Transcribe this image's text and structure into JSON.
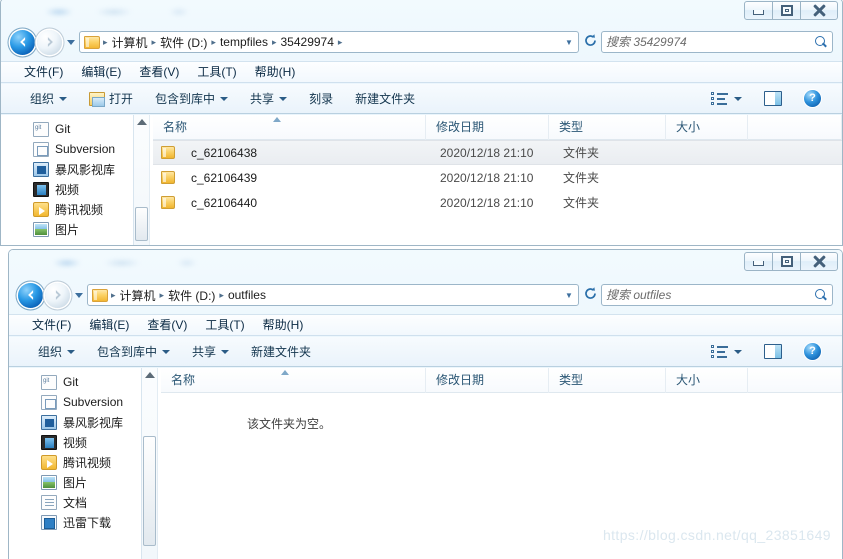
{
  "windows": [
    {
      "id": "win-tempfiles",
      "breadcrumb": {
        "items": [
          "计算机",
          "软件 (D:)",
          "tempfiles",
          "35429974"
        ],
        "separator": "▸"
      },
      "search": {
        "placeholder": "搜索 35429974",
        "value": ""
      },
      "menubar": [
        "文件(F)",
        "编辑(E)",
        "查看(V)",
        "工具(T)",
        "帮助(H)"
      ],
      "toolbar": {
        "organize": "组织",
        "open": "打开",
        "include_in_library": "包含到库中",
        "share": "共享",
        "burn": "刻录",
        "new_folder": "新建文件夹",
        "help_glyph": "?"
      },
      "nav_items": [
        "Git",
        "Subversion",
        "暴风影视库",
        "视频",
        "腾讯视频",
        "图片"
      ],
      "columns": [
        "名称",
        "修改日期",
        "类型",
        "大小"
      ],
      "rows": [
        {
          "name": "c_62106438",
          "modified": "2020/12/18 21:10",
          "type": "文件夹",
          "size": "",
          "selected": true
        },
        {
          "name": "c_62106439",
          "modified": "2020/12/18 21:10",
          "type": "文件夹",
          "size": "",
          "selected": false
        },
        {
          "name": "c_62106440",
          "modified": "2020/12/18 21:10",
          "type": "文件夹",
          "size": "",
          "selected": false
        }
      ],
      "empty_message": ""
    },
    {
      "id": "win-outfiles",
      "breadcrumb": {
        "items": [
          "计算机",
          "软件 (D:)",
          "outfiles"
        ],
        "separator": "▸"
      },
      "search": {
        "placeholder": "搜索 outfiles",
        "value": ""
      },
      "menubar": [
        "文件(F)",
        "编辑(E)",
        "查看(V)",
        "工具(T)",
        "帮助(H)"
      ],
      "toolbar": {
        "organize": "组织",
        "open": "",
        "include_in_library": "包含到库中",
        "share": "共享",
        "burn": "",
        "new_folder": "新建文件夹",
        "help_glyph": "?"
      },
      "nav_items": [
        "Git",
        "Subversion",
        "暴风影视库",
        "视频",
        "腾讯视频",
        "图片",
        "文档",
        "迅雷下载"
      ],
      "columns": [
        "名称",
        "修改日期",
        "类型",
        "大小"
      ],
      "rows": [],
      "empty_message": "该文件夹为空。"
    }
  ],
  "watermark": "https://blog.csdn.net/qq_23851649",
  "colors": {
    "accent_blue": "#2a6faa",
    "titlebar_glass": "#e9f4fc",
    "selection": "#eef1f4",
    "folder_yellow": "#f9cf63"
  }
}
